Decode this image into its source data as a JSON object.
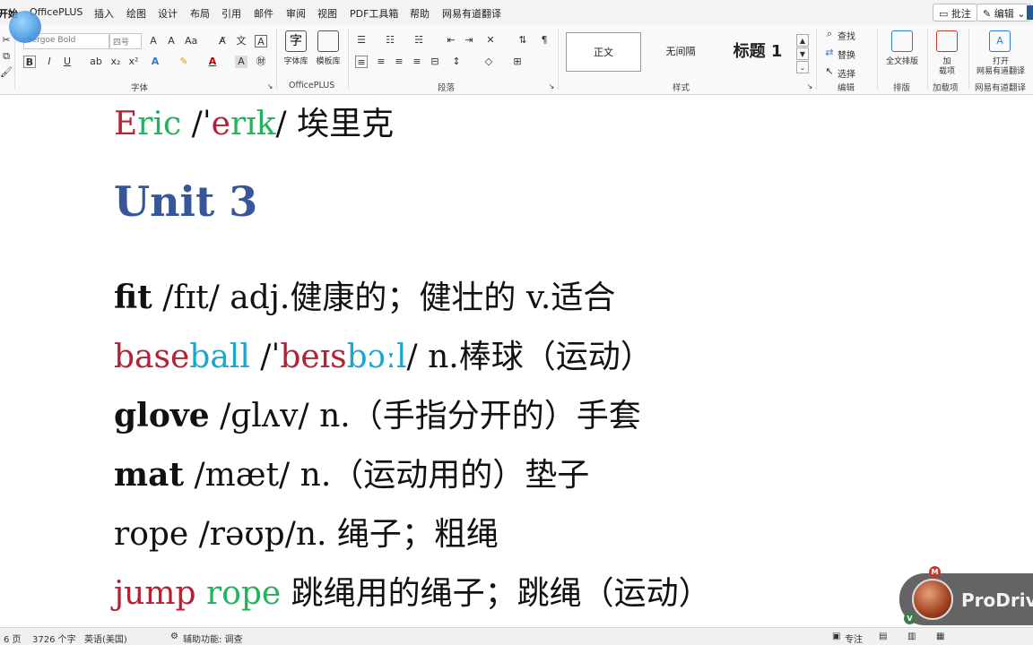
{
  "tabs": [
    "开始",
    "OfficePLUS",
    "插入",
    "绘图",
    "设计",
    "布局",
    "引用",
    "邮件",
    "审阅",
    "视图",
    "PDF工具箱",
    "帮助",
    "网易有道翻译"
  ],
  "top_right": {
    "comment_label": "批注",
    "edit_label": "编辑"
  },
  "ribbon": {
    "font": {
      "font_name": "Sergoe Bold",
      "font_size": "四号",
      "group_label": "字体",
      "bold": "B",
      "italic": "I",
      "underline": "U"
    },
    "officeplus": {
      "font_lib_label": "字体库",
      "template_lib_label": "模板库",
      "group_label": "OfficePLUS"
    },
    "paragraph": {
      "group_label": "段落"
    },
    "styles": {
      "items": [
        "正文",
        "无间隔",
        "标题 1"
      ],
      "group_label": "样式"
    },
    "editing": {
      "find_label": "查找",
      "replace_label": "替换",
      "select_label": "选择",
      "group_label": "编辑"
    },
    "layout": {
      "full_layout_label": "全文排版",
      "group_label": "排版"
    },
    "addins": {
      "addin_label_1": "加",
      "addin_label_2": "载项",
      "group_label": "加载项"
    },
    "youdao": {
      "open_label_1": "打开",
      "open_label_2": "网易有道翻译",
      "group_label": "网易有道翻译"
    }
  },
  "document": {
    "eric": {
      "e": "E",
      "rest": "ric",
      "ipa_pre": " /ˈ",
      "ipa_e": "e",
      "ipa_rest": "rɪk",
      "ipa_post": "/",
      "cn": " 埃里克"
    },
    "unit_heading": "Unit 3",
    "fit": {
      "word": "fit",
      "rest": " /fɪt/ adj.健康的；健壮的  v.适合"
    },
    "baseball": {
      "w1": "base",
      "w2": "ball",
      "ipa_pre": " /ˈ",
      "ipa_1": "beɪs",
      "ipa_2": "bɔːl",
      "ipa_post": "/",
      "cn": " n.棒球（运动）"
    },
    "glove": {
      "word": "glove",
      "rest": " /ɡlʌv/ n.（手指分开的）手套"
    },
    "mat": {
      "word": "mat",
      "rest": " /mæt/ n.（运动用的）垫子"
    },
    "rope": {
      "word": "rope",
      "rest": " /rəʊp/n.  绳子；粗绳"
    },
    "jump_rope": {
      "w1": "jump",
      "w2": "rope",
      "rest": "  跳绳用的绳子；跳绳（运动）"
    }
  },
  "status": {
    "page": "6 页",
    "word_count": "3726 个字",
    "language": "英语(美国)",
    "accessibility": "辅助功能: 调查",
    "focus": "专注"
  },
  "overlay": {
    "prodrive_text": "ProDriv",
    "badge_m": "M",
    "badge_v": "V"
  }
}
